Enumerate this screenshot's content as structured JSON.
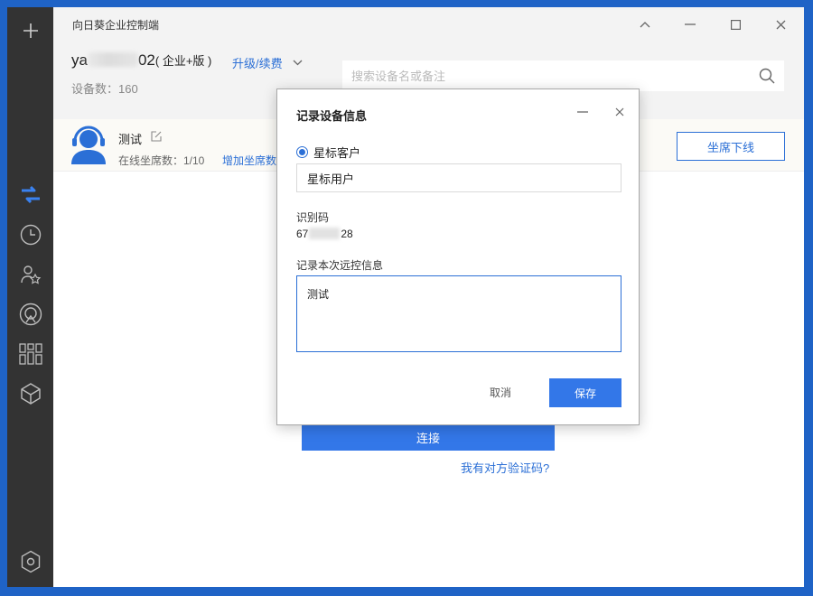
{
  "app": {
    "title": "向日葵企业控制端",
    "account_prefix": "ya",
    "account_suffix": "02",
    "edition": "( 企业+版 )",
    "upgrade_label": "升级/续费",
    "device_count": "设备数：160",
    "search_placeholder": "搜索设备名或备注"
  },
  "agent": {
    "name": "测试",
    "seat_count": "在线坐席数：1/10",
    "add_seat_label": "增加坐席数",
    "offline_label": "坐席下线"
  },
  "main": {
    "connect_label": "连接",
    "verify_link": "我有对方验证码?"
  },
  "dialog": {
    "title": "记录设备信息",
    "radio_label": "星标客户",
    "name_value": "星标用户",
    "id_label": "识别码",
    "id_prefix": "67",
    "id_suffix": "28",
    "note_label": "记录本次远控信息",
    "note_value": "测试",
    "cancel_label": "取消",
    "save_label": "保存"
  },
  "colors": {
    "accent": "#3377e8",
    "link": "#2b6fd6",
    "sidebar": "#333333",
    "sidebar_active": "#3a82f0",
    "frame": "#1f63c6"
  },
  "icons": {
    "sidebar": [
      "plus-icon",
      "remote-control-icon",
      "history-icon",
      "contacts-icon",
      "discover-icon",
      "apps-icon",
      "package-icon",
      "settings-icon"
    ]
  }
}
